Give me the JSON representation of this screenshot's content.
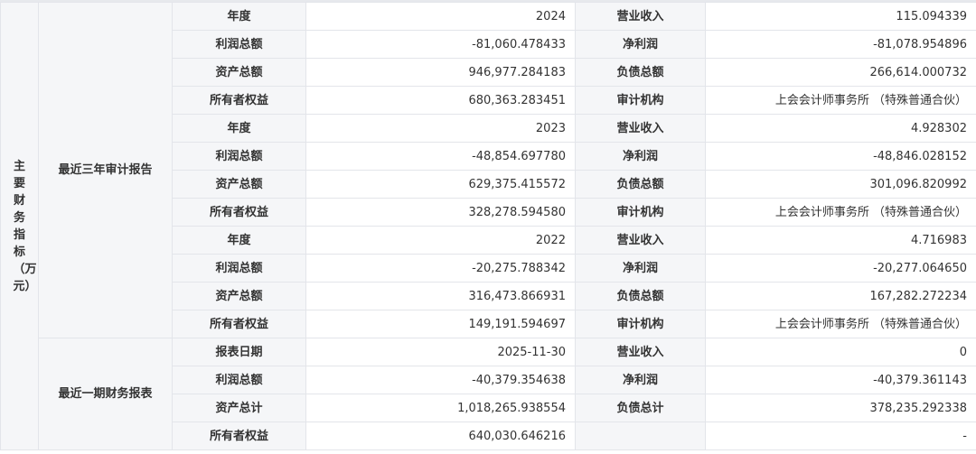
{
  "main_category": "主要财务指标（万元）",
  "annual_section": {
    "title": "最近三年审计报告",
    "years": [
      {
        "rows": [
          {
            "l1": "年度",
            "v1": "2024",
            "l2": "营业收入",
            "v2": "115.094339"
          },
          {
            "l1": "利润总额",
            "v1": "-81,060.478433",
            "l2": "净利润",
            "v2": "-81,078.954896"
          },
          {
            "l1": "资产总额",
            "v1": "946,977.284183",
            "l2": "负债总额",
            "v2": "266,614.000732"
          },
          {
            "l1": "所有者权益",
            "v1": "680,363.283451",
            "l2": "审计机构",
            "v2": "上会会计师事务所 （特殊普通合伙）"
          }
        ]
      },
      {
        "rows": [
          {
            "l1": "年度",
            "v1": "2023",
            "l2": "营业收入",
            "v2": "4.928302"
          },
          {
            "l1": "利润总额",
            "v1": "-48,854.697780",
            "l2": "净利润",
            "v2": "-48,846.028152"
          },
          {
            "l1": "资产总额",
            "v1": "629,375.415572",
            "l2": "负债总额",
            "v2": "301,096.820992"
          },
          {
            "l1": "所有者权益",
            "v1": "328,278.594580",
            "l2": "审计机构",
            "v2": "上会会计师事务所 （特殊普通合伙）"
          }
        ]
      },
      {
        "rows": [
          {
            "l1": "年度",
            "v1": "2022",
            "l2": "营业收入",
            "v2": "4.716983"
          },
          {
            "l1": "利润总额",
            "v1": "-20,275.788342",
            "l2": "净利润",
            "v2": "-20,277.064650"
          },
          {
            "l1": "资产总额",
            "v1": "316,473.866931",
            "l2": "负债总额",
            "v2": "167,282.272234"
          },
          {
            "l1": "所有者权益",
            "v1": "149,191.594697",
            "l2": "审计机构",
            "v2": "上会会计师事务所 （特殊普通合伙）"
          }
        ]
      }
    ]
  },
  "recent_section": {
    "title": "最近一期财务报表",
    "rows": [
      {
        "l1": "报表日期",
        "v1": "2025-11-30",
        "l2": "营业收入",
        "v2": "0"
      },
      {
        "l1": "利润总额",
        "v1": "-40,379.354638",
        "l2": "净利润",
        "v2": "-40,379.361143"
      },
      {
        "l1": "资产总计",
        "v1": "1,018,265.938554",
        "l2": "负债总计",
        "v2": "378,235.292338"
      },
      {
        "l1": "所有者权益",
        "v1": "640,030.646216",
        "l2": "",
        "v2": "-"
      }
    ]
  }
}
